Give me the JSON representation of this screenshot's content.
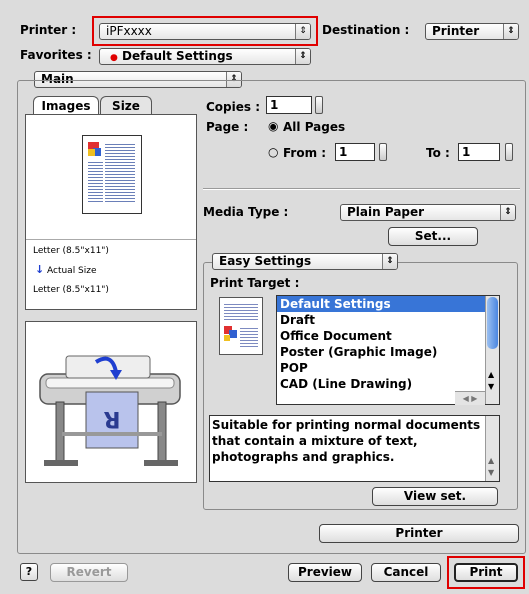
{
  "header": {
    "printer_label": "Printer :",
    "printer_value": "iPFxxxx",
    "destination_label": "Destination :",
    "destination_value": "Printer",
    "favorites_label": "Favorites :",
    "favorites_value": "Default Settings"
  },
  "section_popup": "Main",
  "tabs": [
    "Images",
    "Size"
  ],
  "preview": {
    "paper_line1": "Letter (8.5\"x11\")",
    "actual_size": "Actual Size",
    "paper_line2": "Letter (8.5\"x11\")"
  },
  "copies": {
    "label": "Copies :",
    "value": "1"
  },
  "page": {
    "label": "Page :",
    "all_pages": "All Pages",
    "from_label": "From :",
    "from_value": "1",
    "to_label": "To :",
    "to_value": "1"
  },
  "media": {
    "label": "Media Type :",
    "value": "Plain Paper",
    "set_button": "Set..."
  },
  "easy": {
    "popup": "Easy Settings",
    "target_label": "Print Target :",
    "targets": [
      "Default Settings",
      "Draft",
      "Office Document",
      "Poster (Graphic Image)",
      "POP",
      "CAD (Line Drawing)"
    ],
    "selected_index": 0,
    "description": "Suitable for printing normal documents that contain a mixture of text, photographs and graphics.",
    "view_button": "View set."
  },
  "printer_button": "Printer",
  "footer": {
    "help_icon": "?",
    "revert": "Revert",
    "preview": "Preview",
    "cancel": "Cancel",
    "print": "Print"
  },
  "colors": {
    "highlight": "#e00000",
    "selection": "#3875d7"
  }
}
